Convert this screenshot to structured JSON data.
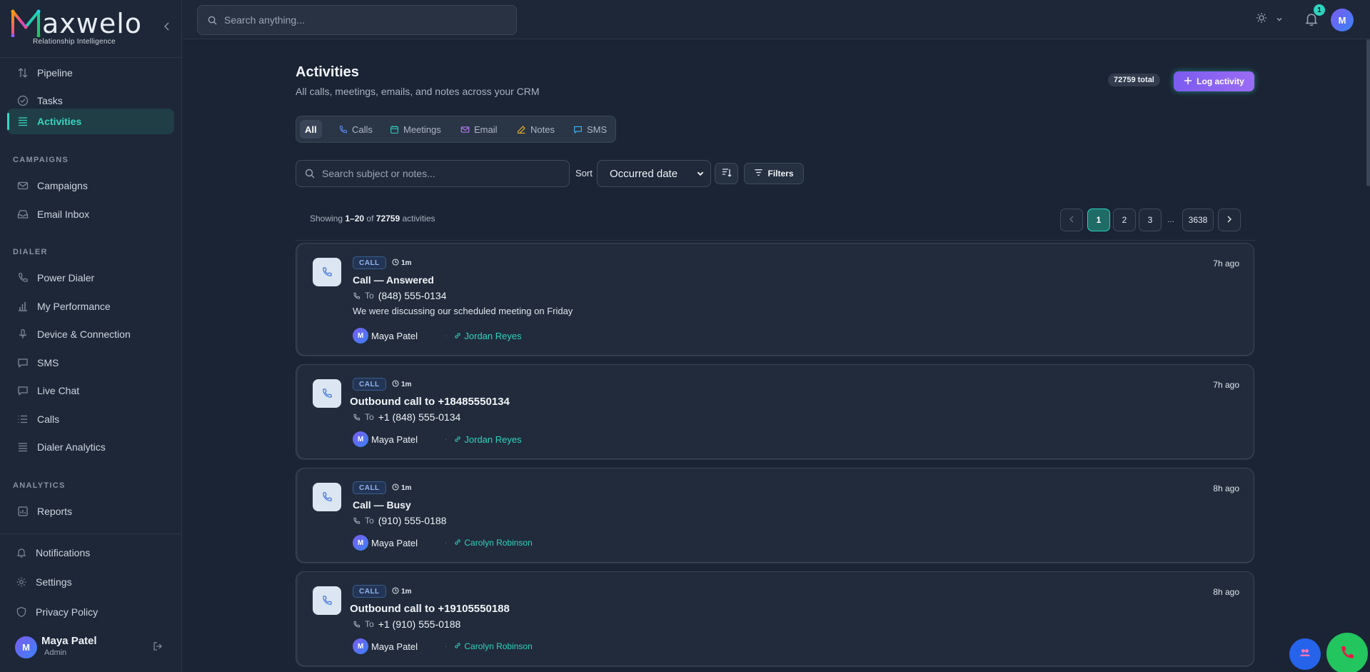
{
  "brand": {
    "name": "axwelo",
    "tagline": "Relationship Intelligence"
  },
  "sidebar": {
    "items_top": [
      {
        "label": "Pipeline",
        "icon": "pipeline-icon"
      },
      {
        "label": "Tasks",
        "icon": "check-circle-icon"
      },
      {
        "label": "Activities",
        "icon": "list-icon",
        "active": true
      }
    ],
    "sections": {
      "campaigns": "CAMPAIGNS",
      "dialer": "DIALER",
      "analytics": "ANALYTICS"
    },
    "campaign_items": [
      {
        "label": "Campaigns",
        "icon": "mail-icon"
      },
      {
        "label": "Email Inbox",
        "icon": "inbox-icon"
      }
    ],
    "dialer_items": [
      {
        "label": "Power Dialer",
        "icon": "phone-icon"
      },
      {
        "label": "My Performance",
        "icon": "bar-chart-icon"
      },
      {
        "label": "Device & Connection",
        "icon": "mic-icon"
      },
      {
        "label": "SMS",
        "icon": "message-icon"
      },
      {
        "label": "Live Chat",
        "icon": "chat-icon"
      },
      {
        "label": "Calls",
        "icon": "list-icon"
      },
      {
        "label": "Dialer Analytics",
        "icon": "list-icon"
      }
    ],
    "analytics_items": [
      {
        "label": "Reports",
        "icon": "report-icon"
      }
    ],
    "bottom_items": [
      {
        "label": "Notifications",
        "icon": "bell-icon"
      },
      {
        "label": "Settings",
        "icon": "gear-icon"
      },
      {
        "label": "Privacy Policy",
        "icon": "shield-icon"
      }
    ],
    "user": {
      "initial": "M",
      "name": "Maya Patel",
      "role": "Admin"
    }
  },
  "topbar": {
    "search_placeholder": "Search anything...",
    "notification_count": "1",
    "avatar_initial": "M"
  },
  "page": {
    "title": "Activities",
    "subtitle": "All calls, meetings, emails, and notes across your CRM",
    "total_badge": "72759 total",
    "log_button": "Log activity",
    "tabs": [
      {
        "label": "All",
        "active": true
      },
      {
        "label": "Calls",
        "icon": "phone-icon"
      },
      {
        "label": "Meetings",
        "icon": "calendar-icon"
      },
      {
        "label": "Email",
        "icon": "mail-icon"
      },
      {
        "label": "Notes",
        "icon": "edit-icon"
      },
      {
        "label": "SMS",
        "icon": "message-icon"
      }
    ],
    "search_placeholder": "Search subject or notes...",
    "sort_label": "Sort",
    "sort_value": "Occurred date",
    "filters_label": "Filters",
    "showing": {
      "prefix": "Showing",
      "range": "1–20",
      "of": "of",
      "total": "72759",
      "suffix": "activities"
    },
    "pagination": {
      "pages": [
        "1",
        "2",
        "3"
      ],
      "ellipsis": "...",
      "last": "3638",
      "current": "1"
    }
  },
  "activities": [
    {
      "badge": "CALL",
      "duration": "1m",
      "time": "7h ago",
      "title": "Call — Answered",
      "to_label": "To",
      "to": "(848) 555-0134",
      "note": "We were discussing our scheduled meeting on Friday",
      "owner_initial": "M",
      "owner": "Maya Patel",
      "contact": "Jordan Reyes"
    },
    {
      "badge": "CALL",
      "duration": "1m",
      "time": "7h ago",
      "title": "Outbound call to +18485550134",
      "to_label": "To",
      "to": "+1 (848) 555-0134",
      "owner_initial": "M",
      "owner": "Maya Patel",
      "contact": "Jordan Reyes"
    },
    {
      "badge": "CALL",
      "duration": "1m",
      "time": "8h ago",
      "title": "Call — Busy",
      "to_label": "To",
      "to": "(910) 555-0188",
      "owner_initial": "M",
      "owner": "Maya Patel",
      "contact": "Carolyn Robinson"
    },
    {
      "badge": "CALL",
      "duration": "1m",
      "time": "8h ago",
      "title": "Outbound call to +19105550188",
      "to_label": "To",
      "to": "+1 (910) 555-0188",
      "owner_initial": "M",
      "owner": "Maya Patel",
      "contact": "Carolyn Robinson"
    }
  ],
  "colors": {
    "accent": "#2dd4bf",
    "primary_button": "#8b5cf6",
    "background": "#1b2434"
  }
}
